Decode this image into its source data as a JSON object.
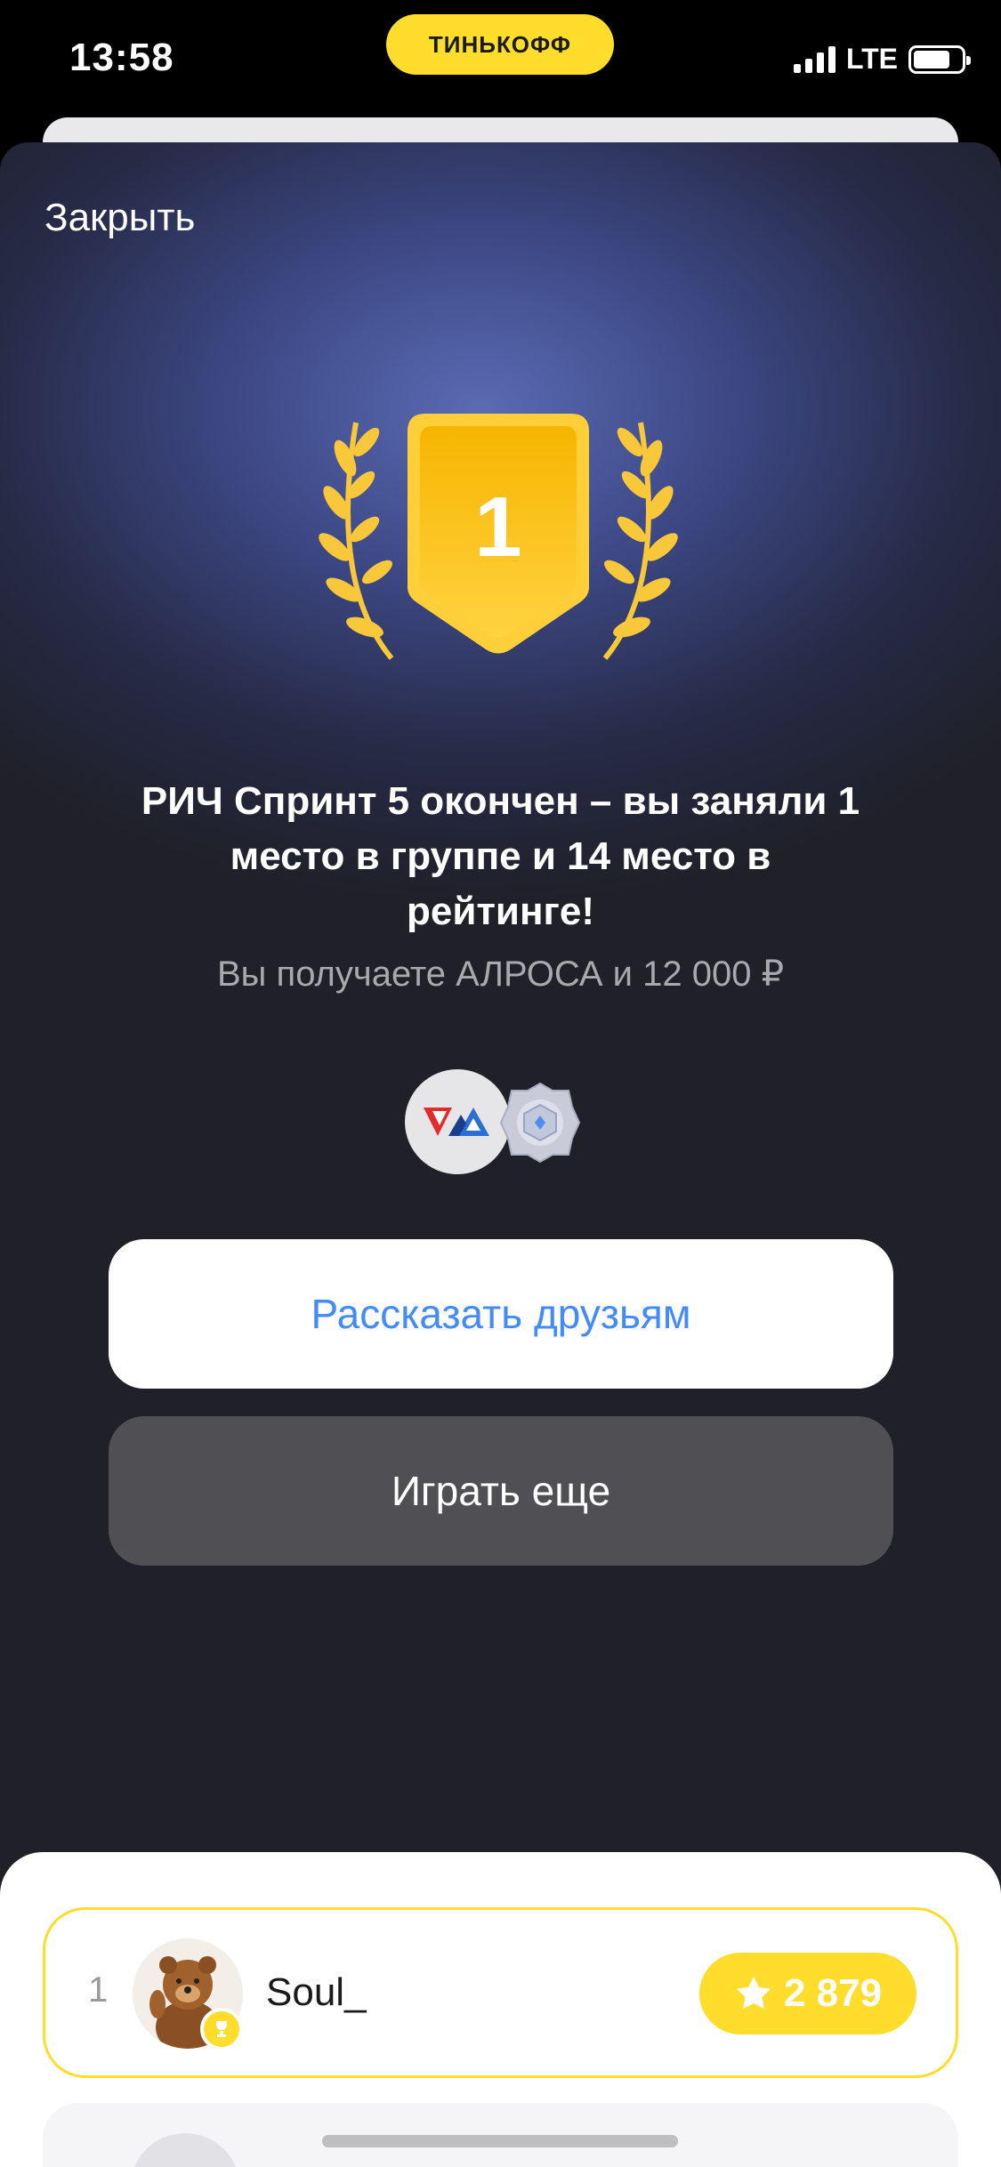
{
  "status_bar": {
    "time": "13:58",
    "brand": "ТИНЬКОФФ",
    "network": "LTE",
    "icons": [
      "signal-icon",
      "battery-icon"
    ]
  },
  "modal": {
    "close_label": "Закрыть",
    "badge_place": "1",
    "title": "РИЧ Спринт 5 окончен – вы заняли 1 место в группе и 14 место в рейтинге!",
    "subtitle": "Вы получаете АЛРОСА и 12 000 ₽",
    "rewards": [
      "alrosa-logo-icon",
      "crystal-badge-icon"
    ],
    "share_button": "Рассказать друзьям",
    "play_again_button": "Играть еще"
  },
  "leaderboard": {
    "rows": [
      {
        "rank": "1",
        "name": "Soul_",
        "score": "2 879",
        "highlighted": true
      }
    ]
  },
  "colors": {
    "accent_yellow": "#ffdd2d",
    "link_blue": "#428bf9",
    "secondary_button": "#505054"
  }
}
